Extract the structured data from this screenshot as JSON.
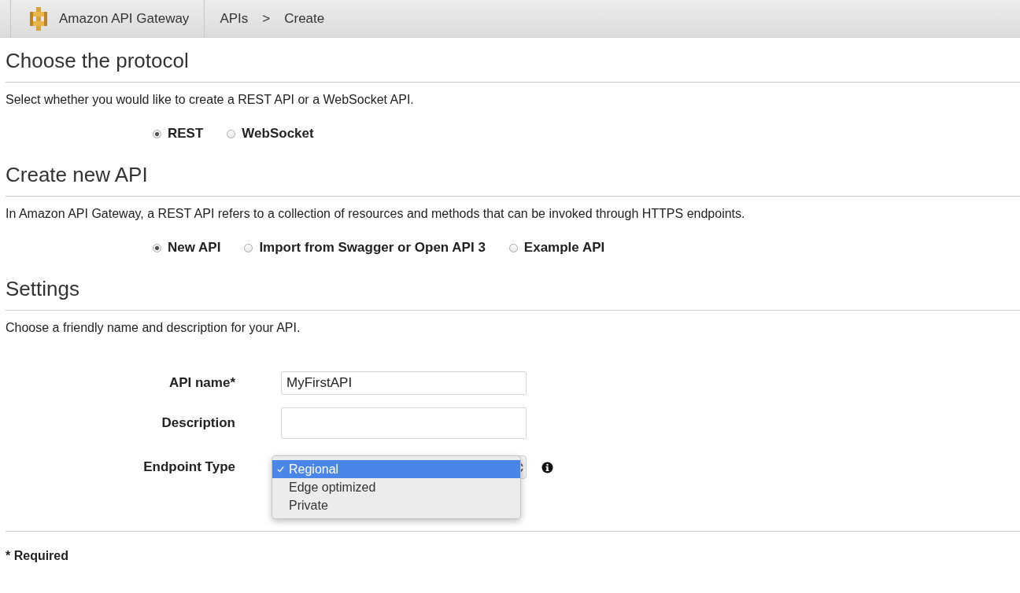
{
  "header": {
    "service": "Amazon API Gateway",
    "breadcrumb": [
      "APIs",
      ">",
      "Create"
    ]
  },
  "sections": [
    {
      "title": "Choose the protocol",
      "description": "Select whether you would like to create a REST API or a WebSocket API.",
      "options": [
        {
          "label": "REST",
          "selected": true
        },
        {
          "label": "WebSocket",
          "selected": false
        }
      ]
    },
    {
      "title": "Create new API",
      "description": "In Amazon API Gateway, a REST API refers to a collection of resources and methods that can be invoked through HTTPS endpoints.",
      "options": [
        {
          "label": "New API",
          "selected": true
        },
        {
          "label": "Import from Swagger or Open API 3",
          "selected": false
        },
        {
          "label": "Example API",
          "selected": false
        }
      ]
    }
  ],
  "settings": {
    "title": "Settings",
    "description": "Choose a friendly name and description for your API.",
    "fields": [
      {
        "kind": "text",
        "label": "API name*",
        "value": "MyFirstAPI"
      },
      {
        "kind": "textarea",
        "label": "Description"
      },
      {
        "kind": "select",
        "label": "Endpoint Type",
        "expanded": true,
        "options": [
          {
            "label": "Regional",
            "selected": true
          },
          {
            "label": "Edge optimized",
            "selected": false
          },
          {
            "label": "Private",
            "selected": false
          }
        ]
      }
    ]
  },
  "footer": "* Required"
}
